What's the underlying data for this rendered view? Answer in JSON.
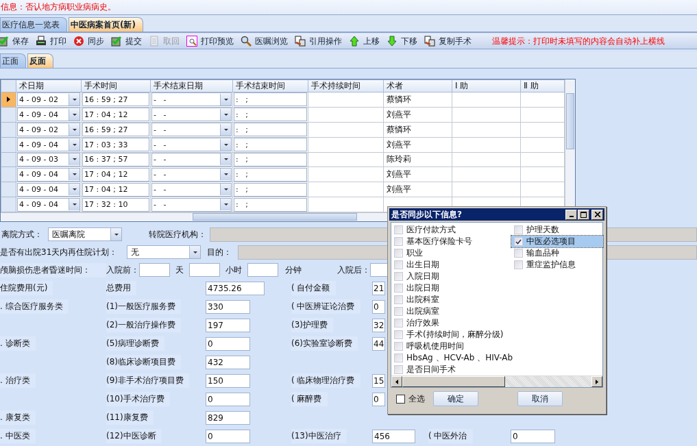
{
  "notice": "信息：否认地方病职业病病史。",
  "tabs": [
    {
      "label": "医疗信息一览表",
      "selected": false
    },
    {
      "label": "中医病案首页(新)",
      "selected": true
    }
  ],
  "toolbar": [
    {
      "label": "保存",
      "disabled": false
    },
    {
      "label": "打印",
      "disabled": false
    },
    {
      "label": "同步",
      "disabled": false
    },
    {
      "label": "提交",
      "disabled": false
    },
    {
      "label": "取回",
      "disabled": true
    },
    {
      "label": "打印预览",
      "disabled": false
    },
    {
      "label": "医嘱浏览",
      "disabled": false
    },
    {
      "label": "引用操作",
      "disabled": false
    },
    {
      "label": "上移",
      "disabled": false
    },
    {
      "label": "下移",
      "disabled": false
    },
    {
      "label": "复制手术",
      "disabled": false
    }
  ],
  "tip": "温馨提示：打印时未填写的内容会自动补上横线",
  "sides": [
    {
      "label": "正面",
      "selected": false
    },
    {
      "label": "反面",
      "selected": true
    }
  ],
  "surgery_table": {
    "columns": [
      "术日期",
      "手术时间",
      "手术结束日期",
      "手术结束时间",
      "手术持续时间",
      "术者",
      "Ⅰ 助",
      "Ⅱ 助"
    ],
    "rows": [
      {
        "selected": true,
        "date": "4 - 09 - 02",
        "time": "16 : 59 ; 27",
        "end_date": "-   -",
        "end_time": ":   ;",
        "surgeon": "蔡憐环"
      },
      {
        "selected": false,
        "date": "4 - 09 - 04",
        "time": "17 : 04 ; 12",
        "end_date": "-   -",
        "end_time": ":   ;",
        "surgeon": "刘燕平"
      },
      {
        "selected": false,
        "date": "4 - 09 - 02",
        "time": "16 : 59 ; 27",
        "end_date": "-   -",
        "end_time": ":   ;",
        "surgeon": "蔡憐环"
      },
      {
        "selected": false,
        "date": "4 - 09 - 04",
        "time": "17 : 03 ; 33",
        "end_date": "-   -",
        "end_time": ":   ;",
        "surgeon": "刘燕平"
      },
      {
        "selected": false,
        "date": "4 - 09 - 03",
        "time": "16 : 37 ; 57",
        "end_date": "-   -",
        "end_time": ":   ;",
        "surgeon": "陈玲莉"
      },
      {
        "selected": false,
        "date": "4 - 09 - 04",
        "time": "17 : 04 ; 12",
        "end_date": "-   -",
        "end_time": ":   ;",
        "surgeon": "刘燕平"
      },
      {
        "selected": false,
        "date": "4 - 09 - 04",
        "time": "17 : 04 ; 12",
        "end_date": "-   -",
        "end_time": ":   ;",
        "surgeon": "刘燕平"
      },
      {
        "selected": false,
        "date": "4 - 09 - 04",
        "time": "17 : 32 : 10",
        "end_date": "-   -",
        "end_time": ":   ;",
        "surgeon": ""
      }
    ]
  },
  "discharge": {
    "mode_label": "离院方式：",
    "mode": "医嘱离院",
    "transfer_label": "转院医疗机构：",
    "readmit_label": "是否有出院31天内再住院计划：",
    "readmit": "无",
    "purpose_label": "目的："
  },
  "coma": {
    "label": "颅脑损伤患者昏迷时间：",
    "before_label": "入院前：",
    "day": "天",
    "hour": "小时",
    "minute": "分钟",
    "after_label": "入院后："
  },
  "costs": [
    {
      "category": "住院费用(元)",
      "left": {
        "label": "总费用",
        "value": "4735.26"
      },
      "right": {
        "label": "(   自付金额",
        "value": "21"
      }
    },
    {
      "category": ". 综合医疗服务类",
      "left": {
        "label": "(1)一般医疗服务费",
        "value": "330"
      },
      "right": {
        "label": "( 中医辨证论治费",
        "value": "0"
      }
    },
    {
      "left": {
        "label": "(2)一般治疗操作费",
        "value": "197"
      },
      "right": {
        "label": "(3)护理费",
        "value": "32"
      }
    },
    {
      "category": ". 诊断类",
      "left": {
        "label": "(5)病理诊断费",
        "value": "0"
      },
      "right": {
        "label": "(6)实验室诊断费",
        "value": "44"
      }
    },
    {
      "left": {
        "label": "(8)临床诊断项目费",
        "value": "432"
      }
    },
    {
      "category": ". 治疗类",
      "left": {
        "label": "(9)非手术治疗项目费",
        "value": "150"
      },
      "right": {
        "label": "( 临床物理治疗费",
        "value": "15"
      }
    },
    {
      "left": {
        "label": "(10)手术治疗费",
        "value": "0"
      },
      "right": {
        "label": "( 麻醉费",
        "value": "0"
      }
    },
    {
      "category": ". 康复类",
      "left": {
        "label": "(11)康复费",
        "value": "829"
      }
    },
    {
      "category": ". 中医类",
      "left": {
        "label": "(12)中医诊断",
        "value": "0"
      },
      "right": {
        "label": "(13)中医治疗",
        "value": "456"
      },
      "extra": {
        "label": "( 中医外治",
        "value": "0"
      }
    }
  ],
  "sync_dialog": {
    "title": "是否同步以下信息?",
    "columns": [
      [
        {
          "label": "医疗付款方式",
          "checked": false,
          "selected": false
        },
        {
          "label": "基本医疗保险卡号",
          "checked": false,
          "selected": false
        },
        {
          "label": "职业",
          "checked": false,
          "selected": false
        },
        {
          "label": "出生日期",
          "checked": false,
          "selected": false
        },
        {
          "label": "入院日期",
          "checked": false,
          "selected": false
        },
        {
          "label": "出院日期",
          "checked": false,
          "selected": false
        },
        {
          "label": "出院科室",
          "checked": false,
          "selected": false
        },
        {
          "label": "出院病室",
          "checked": false,
          "selected": false
        },
        {
          "label": "治疗效果",
          "checked": false,
          "selected": false
        },
        {
          "label": "手术(持续时间，麻醉分级)",
          "checked": false,
          "selected": false
        },
        {
          "label": "呼吸机使用时间",
          "checked": false,
          "selected": false
        },
        {
          "label": "HbsAg 、HCV-Ab 、HIV-Ab",
          "checked": false,
          "selected": false
        },
        {
          "label": "是否日间手术",
          "checked": false,
          "selected": false
        }
      ],
      [
        {
          "label": "护理天数",
          "checked": false,
          "selected": false
        },
        {
          "label": "中医必选项目",
          "checked": true,
          "selected": true
        },
        {
          "label": "输血品种",
          "checked": false,
          "selected": false
        },
        {
          "label": "重症监护信息",
          "checked": false,
          "selected": false
        }
      ]
    ],
    "select_all": {
      "label": "全选",
      "checked": false
    },
    "buttons": [
      "确定",
      "取消"
    ]
  }
}
